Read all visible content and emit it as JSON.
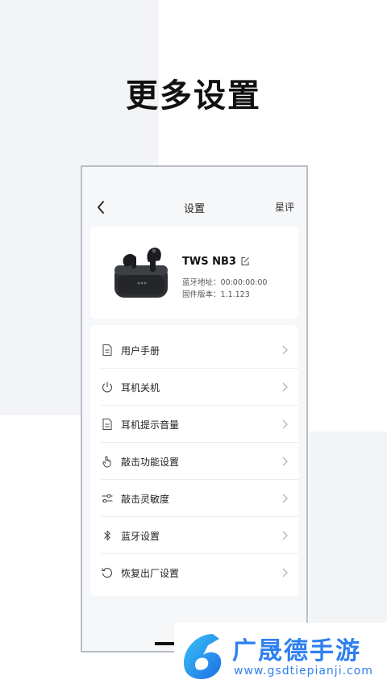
{
  "hero": {
    "title": "更多设置"
  },
  "navbar": {
    "title": "设置",
    "rate_label": "星评"
  },
  "device": {
    "name": "TWS NB3",
    "mac": "蓝牙地址：00:00:00:00",
    "firmware": "固件版本：1.1.123"
  },
  "menu": [
    {
      "label": "用户手册",
      "icon": "document-icon"
    },
    {
      "label": "耳机关机",
      "icon": "power-icon"
    },
    {
      "label": "耳机提示音量",
      "icon": "document-icon"
    },
    {
      "label": "敲击功能设置",
      "icon": "tap-hand-icon"
    },
    {
      "label": "敲击灵敏度",
      "icon": "sliders-icon"
    },
    {
      "label": "蓝牙设置",
      "icon": "bluetooth-icon"
    },
    {
      "label": "恢复出厂设置",
      "icon": "reset-icon"
    }
  ],
  "watermark": {
    "name": "广晟德手游",
    "url": "www.gsdtiepianji.com"
  },
  "colors": {
    "accent": "#2f80f0",
    "page_bg": "#f3f4f6",
    "card_bg": "#ffffff"
  }
}
